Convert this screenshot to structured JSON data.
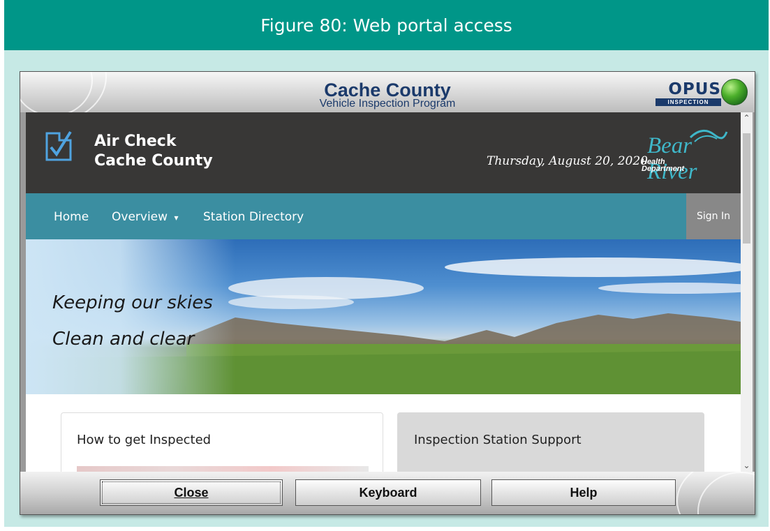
{
  "figure": {
    "caption": "Figure 80: Web portal access"
  },
  "window": {
    "title_main": "Cache County",
    "title_sub": "Vehicle Inspection Program",
    "brand": {
      "name": "OPUS",
      "sub": "INSPECTION"
    }
  },
  "site": {
    "title_line1": "Air Check",
    "title_line2": "Cache County",
    "date": "Thursday, August 20, 2020",
    "dept_main": "Bear River",
    "dept_sub1": "Health",
    "dept_sub2": "Department"
  },
  "nav": {
    "home": "Home",
    "overview": "Overview",
    "overview_caret": "▾",
    "station_directory": "Station Directory",
    "sign_in": "Sign In"
  },
  "hero": {
    "line1": "Keeping our skies",
    "line2": "Clean and clear"
  },
  "cards": {
    "card1_title": "How to get Inspected",
    "card2_title": "Inspection Station Support"
  },
  "buttons": {
    "close_label": "Close",
    "keyboard_label": "Keyboard",
    "help_label": "Help"
  },
  "colors": {
    "figure_header": "#009688",
    "figure_bg": "#c6e9e5",
    "site_header": "#383736",
    "nav_bar": "#3b8ea1",
    "title_text": "#1b3a6b"
  }
}
